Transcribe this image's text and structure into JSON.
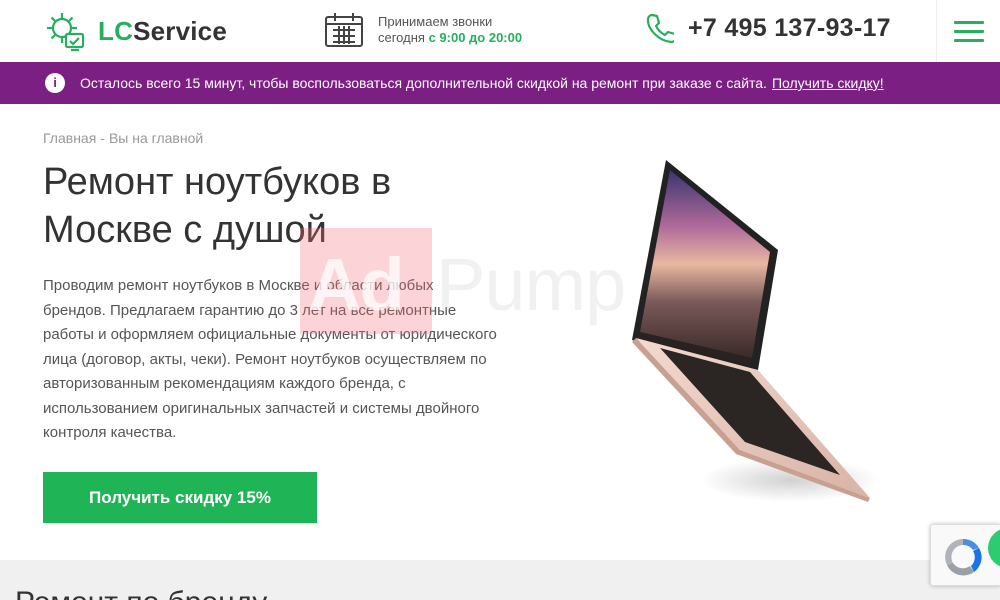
{
  "header": {
    "logo_accent": "LC",
    "logo_rest": "Service",
    "hours_line1": "Принимаем звонки",
    "hours_line2_prefix": "сегодня",
    "hours_time": "с 9:00 до 20:00",
    "phone": "+7 495 137-93-17",
    "menu_icon": "hamburger-menu-icon"
  },
  "promo": {
    "icon": "info-icon",
    "icon_glyph": "i",
    "text": "Осталось всего 15 минут, чтобы воспользоваться дополнительной скидкой на ремонт при заказе с сайта.",
    "link": "Получить скидку!"
  },
  "hero": {
    "breadcrumb_home": "Главная",
    "breadcrumb_sep": "-",
    "breadcrumb_current": "Вы на главной",
    "title": "Ремонт ноутбуков в Москве с душой",
    "description": "Проводим ремонт ноутбуков в Москве и области любых брендов. Предлагаем гарантию до 3 лет на все ремонтные работы и оформляем официальные документы от юридического лица (договор, акты, чеки). Ремонт ноутбуков осуществляем по авторизованным рекомендациям каждого бренда, с использованием оригинальных запчастей и системы двойного контроля качества.",
    "cta": "Получить скидку 15%"
  },
  "watermark": {
    "part1": "Ad",
    "part2": "Pump"
  },
  "brands": {
    "title": "Ремонт по бренду"
  },
  "colors": {
    "accent_green": "#27ae60",
    "promo_purple": "#7b1f82",
    "cta_green": "#1fb556"
  }
}
